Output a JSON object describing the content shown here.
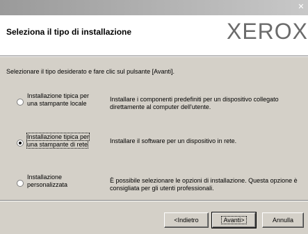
{
  "window": {
    "close_glyph": "✕"
  },
  "header": {
    "title": "Seleziona il tipo di installazione",
    "logo": "XEROX"
  },
  "instruction": "Selezionare il tipo desiderato e fare clic sul pulsante [Avanti].",
  "options": [
    {
      "label_line1": "Installazione tipica per",
      "label_line2": "una stampante locale",
      "description": "Installare i componenti predefiniti per un dispositivo collegato direttamente al computer dell'utente.",
      "selected": false
    },
    {
      "label_line1": "Installazione tipica per",
      "label_line2": "una stampante di rete",
      "description": "Installare il software per un dispositivo in rete.",
      "selected": true
    },
    {
      "label_line1": "Installazione",
      "label_line2": "personalizzata",
      "description": "È possibile selezionare le opzioni di installazione. Questa opzione è consigliata per gli utenti professionali.",
      "selected": false
    }
  ],
  "buttons": {
    "back": "<Indietro",
    "next": "Avanti>",
    "cancel": "Annulla"
  }
}
